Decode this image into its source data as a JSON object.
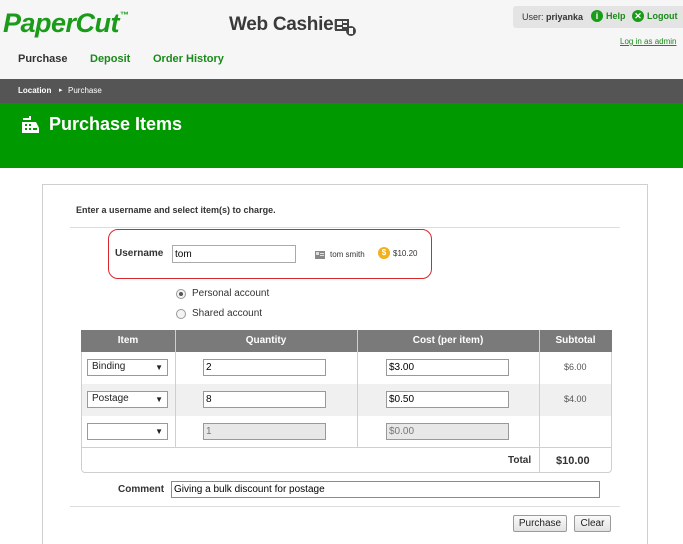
{
  "header": {
    "logo": "PaperCut",
    "logo_tm": "™",
    "app_title": "Web Cashier",
    "user_prefix": "User:",
    "user_name": "priyanka",
    "help_label": "Help",
    "logout_label": "Logout",
    "login_admin_label": "Log in as admin"
  },
  "nav": {
    "items": [
      {
        "label": "Purchase",
        "active": true
      },
      {
        "label": "Deposit",
        "active": false
      },
      {
        "label": "Order History",
        "active": false
      }
    ]
  },
  "breadcrumb": {
    "items": [
      "Location",
      "Purchase"
    ]
  },
  "page": {
    "title": "Purchase Items"
  },
  "form": {
    "intro": "Enter a username and select item(s) to charge.",
    "username_label": "Username",
    "username_value": "tom",
    "user_fullname": "tom smith",
    "user_balance": "$10.20",
    "account_options": [
      {
        "label": "Personal account",
        "selected": true
      },
      {
        "label": "Shared account",
        "selected": false
      }
    ],
    "table": {
      "headers": [
        "Item",
        "Quantity",
        "Cost (per item)",
        "Subtotal"
      ],
      "rows": [
        {
          "item": "Binding",
          "quantity": "2",
          "cost": "$3.00",
          "subtotal": "$6.00"
        },
        {
          "item": "Postage",
          "quantity": "8",
          "cost": "$0.50",
          "subtotal": "$4.00"
        },
        {
          "item": "",
          "quantity": "1",
          "cost": "$0.00",
          "subtotal": ""
        }
      ],
      "total_label": "Total",
      "total_value": "$10.00"
    },
    "comment_label": "Comment",
    "comment_value": "Giving a bulk discount for postage",
    "purchase_button": "Purchase",
    "clear_button": "Clear"
  },
  "colors": {
    "brand_green": "#009a00",
    "alert_red": "#d9272e"
  }
}
